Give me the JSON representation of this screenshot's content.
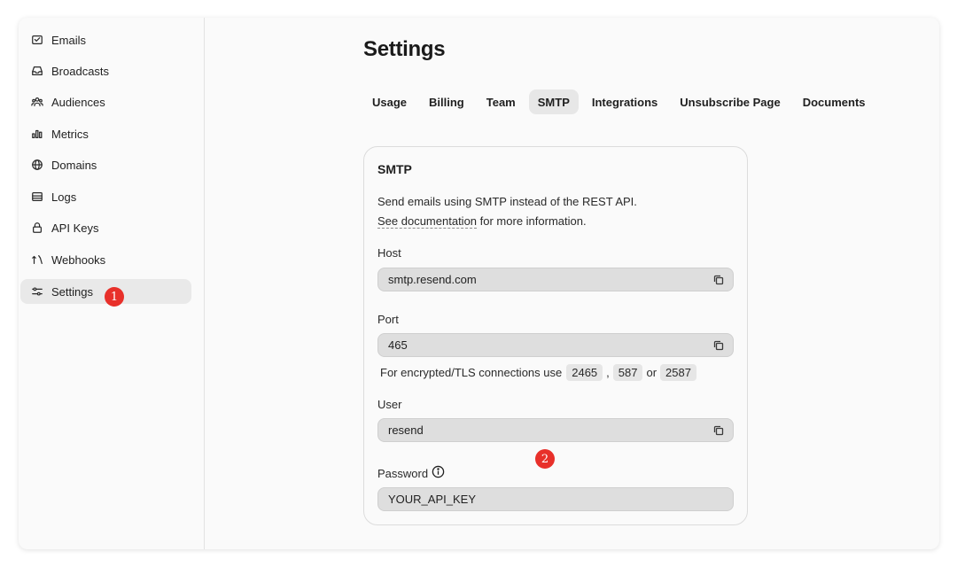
{
  "sidebar": {
    "items": [
      {
        "label": "Emails",
        "icon": "mail-icon"
      },
      {
        "label": "Broadcasts",
        "icon": "inbox-icon"
      },
      {
        "label": "Audiences",
        "icon": "users-icon"
      },
      {
        "label": "Metrics",
        "icon": "bar-chart-icon"
      },
      {
        "label": "Domains",
        "icon": "globe-icon"
      },
      {
        "label": "Logs",
        "icon": "logs-icon"
      },
      {
        "label": "API Keys",
        "icon": "lock-icon"
      },
      {
        "label": "Webhooks",
        "icon": "webhook-icon"
      },
      {
        "label": "Settings",
        "icon": "sliders-icon",
        "active": true
      }
    ]
  },
  "markers": {
    "one": "1",
    "two": "2"
  },
  "page": {
    "title": "Settings"
  },
  "tabs": [
    {
      "label": "Usage"
    },
    {
      "label": "Billing"
    },
    {
      "label": "Team"
    },
    {
      "label": "SMTP",
      "active": true
    },
    {
      "label": "Integrations"
    },
    {
      "label": "Unsubscribe Page"
    },
    {
      "label": "Documents"
    }
  ],
  "smtp": {
    "title": "SMTP",
    "desc_line1": "Send emails using SMTP instead of the REST API.",
    "doc_link": "See documentation",
    "desc_line2_rest": " for more information.",
    "host_label": "Host",
    "host_value": "smtp.resend.com",
    "port_label": "Port",
    "port_value": "465",
    "tls_note": "For encrypted/TLS connections use",
    "tls_ports": [
      "2465",
      "587",
      "2587"
    ],
    "tls_sep1": ",",
    "tls_sep2": "or",
    "user_label": "User",
    "user_value": "resend",
    "password_label": "Password",
    "password_value": "YOUR_API_KEY"
  },
  "colors": {
    "marker": "#e8302a",
    "active_bg": "#e9e9e9"
  }
}
